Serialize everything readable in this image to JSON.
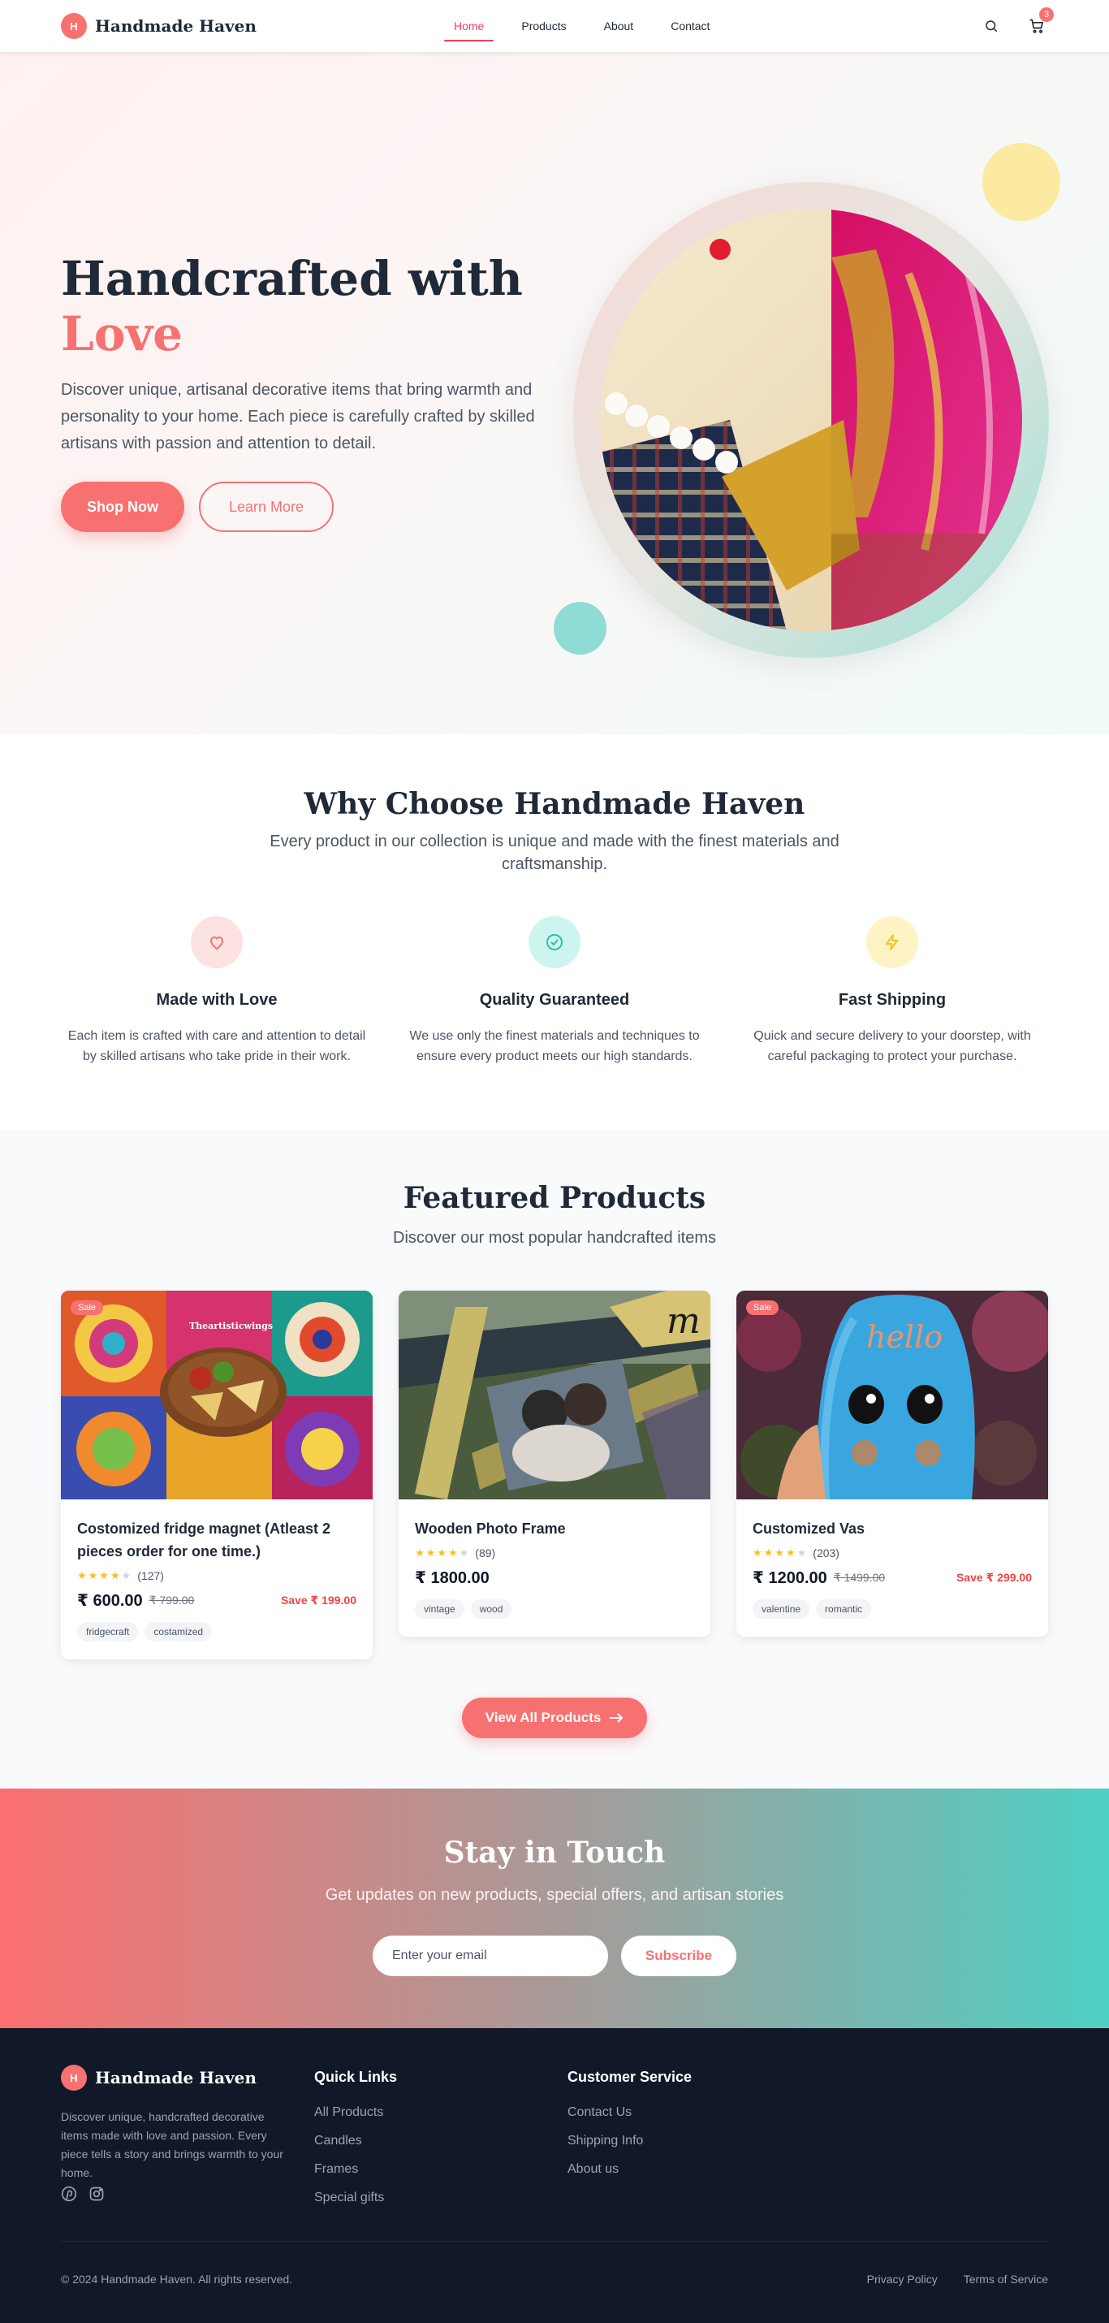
{
  "brand": {
    "logo_letter": "H",
    "name": "Handmade Haven"
  },
  "nav": {
    "links": [
      "Home",
      "Products",
      "About",
      "Contact"
    ],
    "active": "Home",
    "cart_count": "3"
  },
  "hero": {
    "title_line1": "Handcrafted with",
    "title_line2": "Love",
    "description": "Discover unique, artisanal decorative items that bring warmth and personality to your home. Each piece is carefully crafted by skilled artisans with passion and attention to detail.",
    "primary_button": "Shop Now",
    "secondary_button": "Learn More"
  },
  "why": {
    "title": "Why Choose Handmade Haven",
    "subtitle": "Every product in our collection is unique and made with the finest materials and craftsmanship.",
    "features": [
      {
        "title": "Made with Love",
        "description": "Each item is crafted with care and attention to detail by skilled artisans who take pride in their work.",
        "icon": "heart-icon",
        "color": "#f87171"
      },
      {
        "title": "Quality Guaranteed",
        "description": "We use only the finest materials and techniques to ensure every product meets our high standards.",
        "icon": "check-circle-icon",
        "color": "#2dd4bf"
      },
      {
        "title": "Fast Shipping",
        "description": "Quick and secure delivery to your doorstep, with careful packaging to protect your purchase.",
        "icon": "lightning-icon",
        "color": "#facc15"
      }
    ]
  },
  "products": {
    "title": "Featured Products",
    "subtitle": "Discover our most popular handcrafted items",
    "items": [
      {
        "name": "Costomized fridge magnet (Atleast 2 pieces order for one time.)",
        "badge": "Sale",
        "rating": 4,
        "reviews": "(127)",
        "price": "₹ 600.00",
        "old_price": "₹ 799.00",
        "save": "Save ₹ 199.00",
        "tags": [
          "fridgecraft",
          "costamized"
        ],
        "image_caption": "Theartisticwings"
      },
      {
        "name": "Wooden Photo Frame",
        "badge": "",
        "rating": 4,
        "reviews": "(89)",
        "price": "₹ 1800.00",
        "old_price": "",
        "save": "",
        "tags": [
          "vintage",
          "wood"
        ],
        "image_caption": ""
      },
      {
        "name": "Customized Vas",
        "badge": "Sale",
        "rating": 4,
        "reviews": "(203)",
        "price": "₹ 1200.00",
        "old_price": "₹ 1499.00",
        "save": "Save ₹ 299.00",
        "tags": [
          "valentine",
          "romantic"
        ],
        "image_caption": "hello"
      }
    ],
    "view_all": "View All Products"
  },
  "newsletter": {
    "title": "Stay in Touch",
    "subtitle": "Get updates on new products, special offers, and artisan stories",
    "email_placeholder": "Enter your email",
    "button": "Subscribe"
  },
  "footer": {
    "description": "Discover unique, handcrafted decorative items made with love and passion. Every piece tells a story and brings warmth to your home.",
    "quick_links_title": "Quick Links",
    "quick_links": [
      "All Products",
      "Candles",
      "Frames",
      "Special gifts"
    ],
    "service_title": "Customer Service",
    "service_links": [
      "Contact Us",
      "Shipping Info",
      "About us"
    ],
    "copyright": "© 2024 Handmade Haven. All rights reserved.",
    "legal": [
      "Privacy Policy",
      "Terms of Service"
    ]
  },
  "colors": {
    "accent": "#f87171",
    "teal": "#4fd0c4",
    "dark": "#111827"
  }
}
